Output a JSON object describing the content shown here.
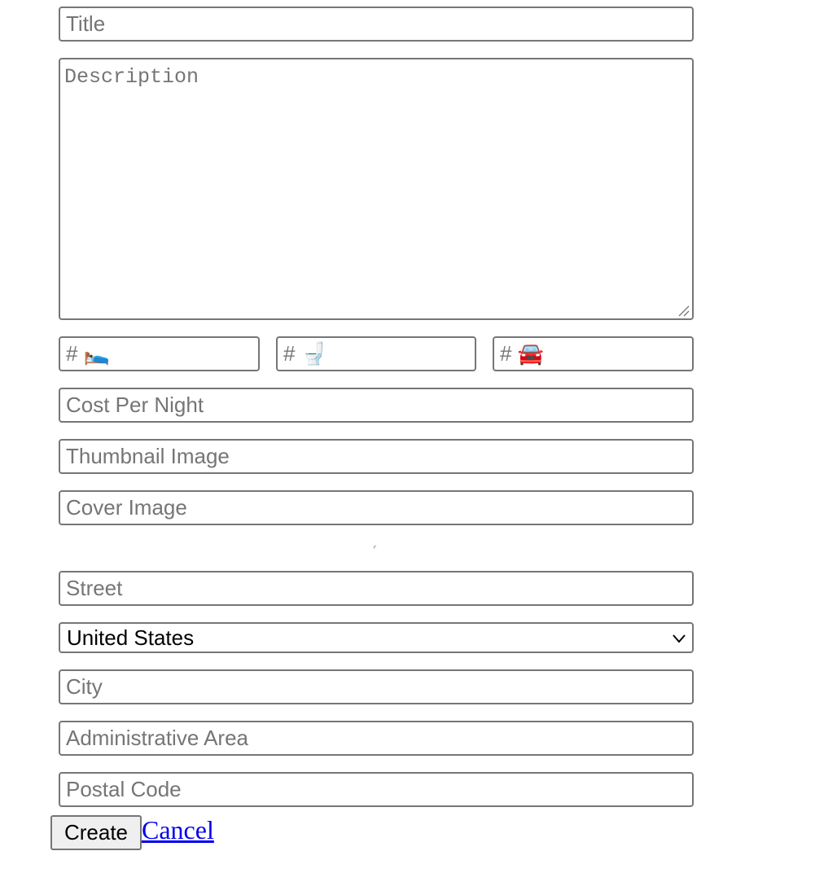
{
  "form": {
    "title_placeholder": "Title",
    "description_placeholder": "Description",
    "bedrooms_placeholder": "# 🛌",
    "bathrooms_placeholder": "# 🚽",
    "parking_placeholder": "# 🚘",
    "cost_placeholder": "Cost Per Night",
    "thumbnail_placeholder": "Thumbnail Image",
    "cover_placeholder": "Cover Image",
    "street_placeholder": "Street",
    "country": {
      "selected": "United States",
      "options": [
        "United States"
      ]
    },
    "city_placeholder": "City",
    "admin_area_placeholder": "Administrative Area",
    "postal_placeholder": "Postal Code",
    "create_label": "Create",
    "cancel_label": "Cancel"
  },
  "icons": {
    "select_arrow": "chevron-down-icon",
    "textarea_grip": "resize-grip-icon"
  },
  "colors": {
    "border": "#767676",
    "placeholder": "#757575",
    "link": "#0000ee",
    "button_bg": "#efefef"
  }
}
